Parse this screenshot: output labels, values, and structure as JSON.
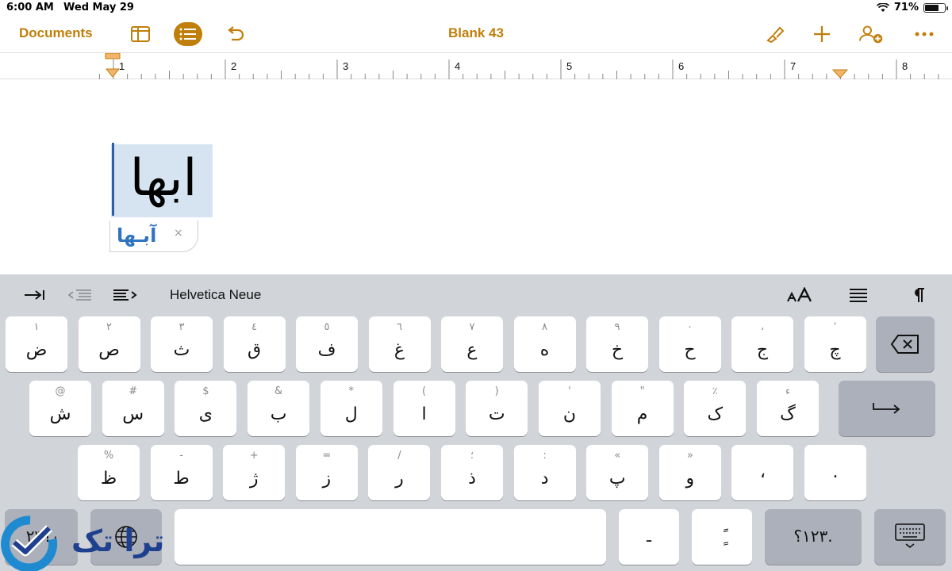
{
  "status": {
    "time": "6:00 AM",
    "date": "Wed May 29",
    "battery": "71%"
  },
  "toolbar": {
    "documents": "Documents",
    "title": "Blank 43"
  },
  "ruler": {
    "numbers": [
      "1",
      "2",
      "3",
      "4",
      "5",
      "6",
      "7",
      "8"
    ]
  },
  "document": {
    "word": "ابها",
    "suggestion": "آبـها",
    "suggestion_dismiss": "×"
  },
  "keyboard": {
    "font_name": "Helvetica Neue",
    "row1": [
      {
        "sec": "١",
        "pri": "ض"
      },
      {
        "sec": "٢",
        "pri": "ص"
      },
      {
        "sec": "٣",
        "pri": "ث"
      },
      {
        "sec": "٤",
        "pri": "ق"
      },
      {
        "sec": "٥",
        "pri": "ف"
      },
      {
        "sec": "٦",
        "pri": "غ"
      },
      {
        "sec": "٧",
        "pri": "ع"
      },
      {
        "sec": "٨",
        "pri": "ه"
      },
      {
        "sec": "٩",
        "pri": "خ"
      },
      {
        "sec": "٠",
        "pri": "ح"
      },
      {
        "sec": "،",
        "pri": "ج"
      },
      {
        "sec": "٬",
        "pri": "چ"
      }
    ],
    "row2": [
      {
        "sec": "@",
        "pri": "ش"
      },
      {
        "sec": "#",
        "pri": "س"
      },
      {
        "sec": "$",
        "pri": "ی"
      },
      {
        "sec": "&",
        "pri": "ب"
      },
      {
        "sec": "*",
        "pri": "ل"
      },
      {
        "sec": "(",
        "pri": "ا"
      },
      {
        "sec": ")",
        "pri": "ت"
      },
      {
        "sec": "'",
        "pri": "ن"
      },
      {
        "sec": "\"",
        "pri": "م"
      },
      {
        "sec": "٪",
        "pri": "ک"
      },
      {
        "sec": "ء",
        "pri": "گ"
      }
    ],
    "row3": [
      {
        "sec": "%",
        "pri": "ظ"
      },
      {
        "sec": "-",
        "pri": "ط"
      },
      {
        "sec": "+",
        "pri": "ژ"
      },
      {
        "sec": "=",
        "pri": "ز"
      },
      {
        "sec": "/",
        "pri": "ر"
      },
      {
        "sec": "؛",
        "pri": "ذ"
      },
      {
        "sec": ":",
        "pri": "د"
      },
      {
        "sec": "«",
        "pri": "پ"
      },
      {
        "sec": "»",
        "pri": "و"
      },
      {
        "sec": "",
        "pri": "،"
      },
      {
        "sec": "",
        "pri": "."
      }
    ],
    "numbers_key_left": "٫؟٢٣",
    "numbers_key_right": "١٢٣؟.",
    "mark_key_1": "ـ",
    "mark_key_2": "ًٍ"
  },
  "logo": {
    "text": "ترا تک"
  },
  "colors": {
    "accent": "#c07f0a",
    "selection": "#d6e4f1",
    "keyboard_bg": "#d1d4d9"
  }
}
